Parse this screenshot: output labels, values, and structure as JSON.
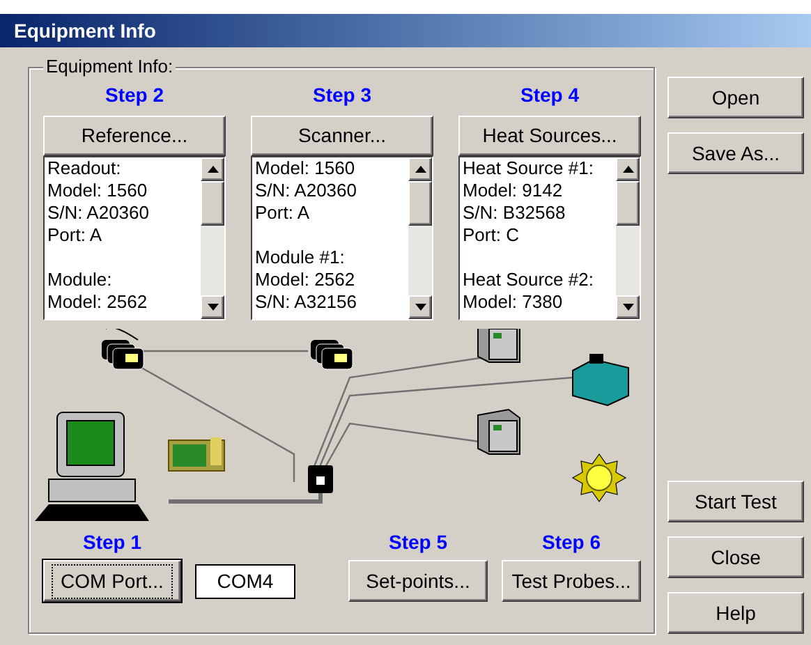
{
  "window": {
    "title": "Equipment Info"
  },
  "group": {
    "label": "Equipment Info:"
  },
  "columns": [
    {
      "step": "Step 2",
      "button": "Reference...",
      "blocks": [
        [
          "Readout:",
          "Model: 1560",
          "S/N: A20360",
          "Port: A"
        ],
        [
          "Module:",
          "Model: 2562"
        ]
      ]
    },
    {
      "step": "Step 3",
      "button": "Scanner...",
      "blocks": [
        [
          "Model: 1560",
          "S/N: A20360",
          "Port: A"
        ],
        [
          "Module #1:",
          "Model: 2562",
          "S/N: A32156"
        ]
      ]
    },
    {
      "step": "Step 4",
      "button": "Heat Sources...",
      "blocks": [
        [
          "Heat Source #1:",
          "Model: 9142",
          "S/N: B32568",
          "Port: C"
        ],
        [
          "Heat Source #2:",
          "Model: 7380"
        ]
      ]
    }
  ],
  "bottom": [
    {
      "step": "Step 1",
      "button": "COM Port...",
      "focused": true,
      "field": "COM4"
    },
    {
      "step": "Step 5",
      "button": "Set-points...",
      "focused": false
    },
    {
      "step": "Step 6",
      "button": "Test Probes...",
      "focused": false
    }
  ],
  "side_buttons_top": [
    "Open",
    "Save As..."
  ],
  "side_buttons_bottom": [
    "Start Test",
    "Close",
    "Help"
  ]
}
